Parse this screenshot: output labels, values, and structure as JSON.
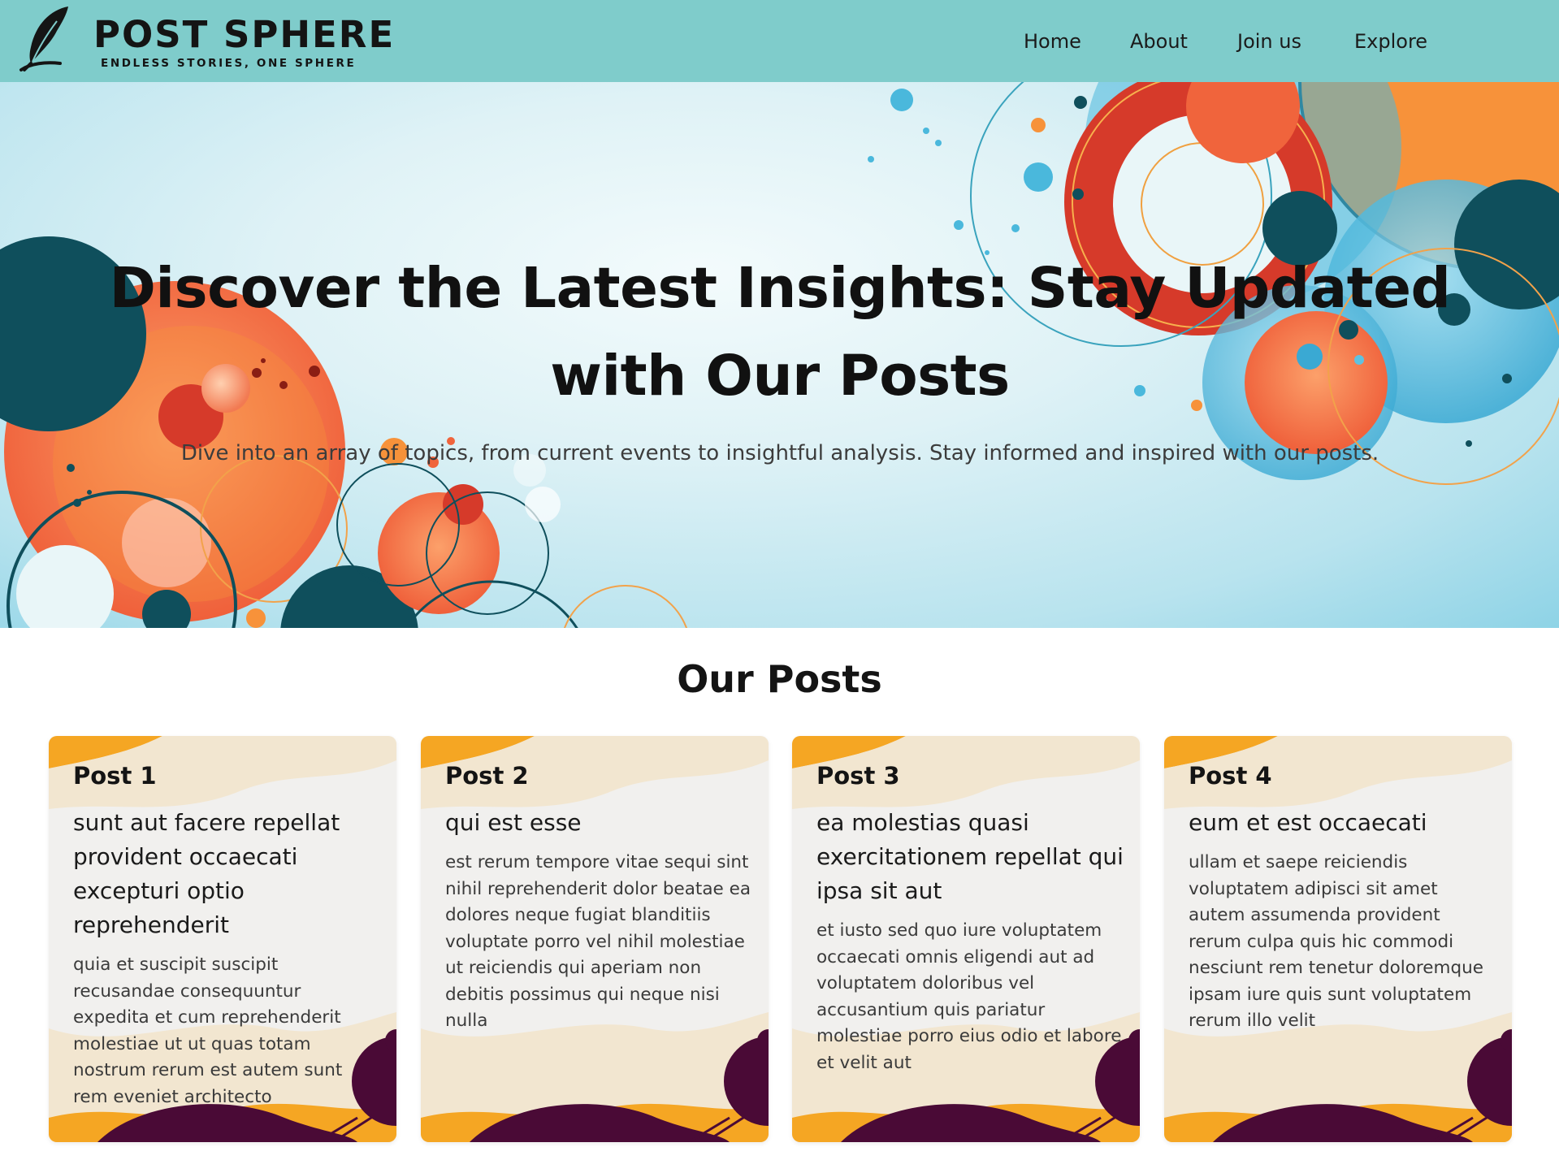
{
  "header": {
    "brand_name": "POST SPHERE",
    "tagline": "ENDLESS STORIES, ONE SPHERE",
    "logo_icon": "feather-quill-icon",
    "background_color": "#7fcccb",
    "nav": [
      {
        "label": "Home"
      },
      {
        "label": "About"
      },
      {
        "label": "Join us"
      },
      {
        "label": "Explore"
      }
    ]
  },
  "hero": {
    "title": "Discover the Latest Insights: Stay Updated with Our Posts",
    "subtitle": "Dive into an array of topics, from current events to insightful analysis. Stay informed and inspired with our posts.",
    "palette": {
      "orange": "#f0643c",
      "light_orange": "#f7923a",
      "red": "#d63a2a",
      "teal_dark": "#0f4f5c",
      "sky_blue": "#4ab8dc"
    }
  },
  "posts": {
    "heading": "Our Posts",
    "items": [
      {
        "label": "Post 1",
        "title": "sunt aut facere repellat provident occaecati excepturi optio reprehenderit",
        "body": "quia et suscipit suscipit recusandae consequuntur expedita et cum reprehenderit molestiae ut ut quas totam nostrum rerum est autem sunt rem eveniet architecto"
      },
      {
        "label": "Post 2",
        "title": "qui est esse",
        "body": "est rerum tempore vitae sequi sint nihil reprehenderit dolor beatae ea dolores neque fugiat blanditiis voluptate porro vel nihil molestiae ut reiciendis qui aperiam non debitis possimus qui neque nisi nulla"
      },
      {
        "label": "Post 3",
        "title": "ea molestias quasi exercitationem repellat qui ipsa sit aut",
        "body": "et iusto sed quo iure voluptatem occaecati omnis eligendi aut ad voluptatem doloribus vel accusantium quis pariatur molestiae porro eius odio et labore et velit aut"
      },
      {
        "label": "Post 4",
        "title": "eum et est occaecati",
        "body": "ullam et saepe reiciendis voluptatem adipisci sit amet autem assumenda provident rerum culpa quis hic commodi nesciunt rem tenetur doloremque ipsam iure quis sunt voluptatem rerum illo velit"
      }
    ],
    "card_palette": {
      "paper": "#f1f0ee",
      "yellow": "#f5a623",
      "cream": "#f2e6d0",
      "plum": "#4a0a36"
    }
  }
}
